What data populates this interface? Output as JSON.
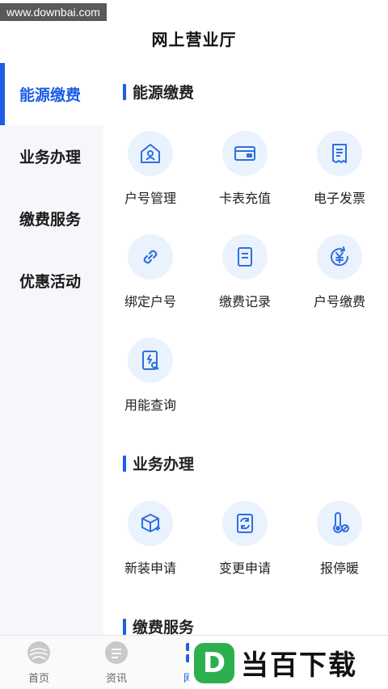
{
  "watermark": "www.downbai.com",
  "header": {
    "title": "网上营业厅"
  },
  "sidebar": {
    "items": [
      {
        "label": "能源缴费",
        "active": true
      },
      {
        "label": "业务办理",
        "active": false
      },
      {
        "label": "缴费服务",
        "active": false
      },
      {
        "label": "优惠活动",
        "active": false
      }
    ]
  },
  "sections": {
    "energy": {
      "title": "能源缴费",
      "items": [
        {
          "label": "户号管理",
          "icon": "house-user-icon"
        },
        {
          "label": "卡表充值",
          "icon": "card-icon"
        },
        {
          "label": "电子发票",
          "icon": "invoice-icon"
        },
        {
          "label": "绑定户号",
          "icon": "link-icon"
        },
        {
          "label": "缴费记录",
          "icon": "record-icon"
        },
        {
          "label": "户号缴费",
          "icon": "yuan-refresh-icon"
        },
        {
          "label": "用能查询",
          "icon": "energy-search-icon"
        }
      ]
    },
    "business": {
      "title": "业务办理",
      "items": [
        {
          "label": "新装申请",
          "icon": "box-add-icon"
        },
        {
          "label": "变更申请",
          "icon": "change-doc-icon"
        },
        {
          "label": "报停暖",
          "icon": "thermometer-stop-icon"
        }
      ]
    },
    "payment": {
      "title": "缴费服务"
    }
  },
  "tabbar": {
    "items": [
      {
        "label": "首页"
      },
      {
        "label": "资讯"
      },
      {
        "label": "网上"
      }
    ]
  },
  "brand_overlay": {
    "logo_letter": "D",
    "text": "当百下载"
  },
  "colors": {
    "accent": "#1c5ee6",
    "icon_bg": "#eaf2fd",
    "icon_stroke": "#2f6fe0",
    "sidebar_bg": "#f5f7fb"
  }
}
